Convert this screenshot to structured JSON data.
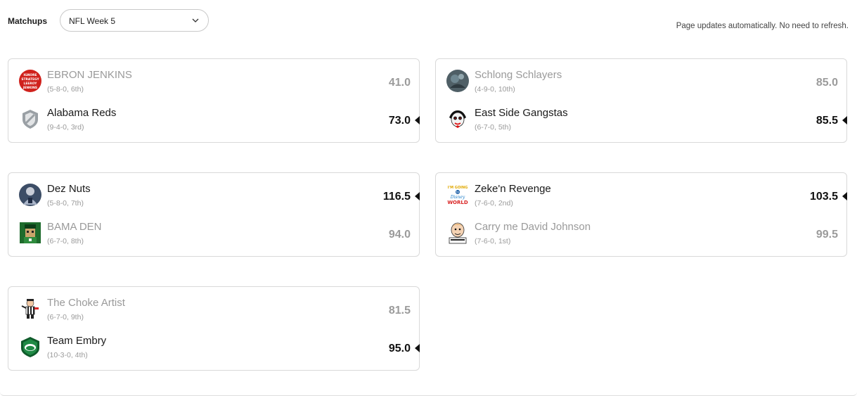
{
  "header": {
    "label": "Matchups",
    "week_select": {
      "value": "NFL Week 5"
    },
    "refresh_note": "Page updates automatically. No need to refresh."
  },
  "matchups": [
    {
      "top": {
        "name": "EBRON JENKINS",
        "record": "(5-8-0, 6th)",
        "score": "41.0",
        "avatar": "ignore-strategy-logo",
        "status": "loser"
      },
      "bottom": {
        "name": "Alabama Reds",
        "record": "(9-4-0, 3rd)",
        "score": "73.0",
        "avatar": "shield-logo",
        "status": "winner"
      }
    },
    {
      "top": {
        "name": "Schlong Schlayers",
        "record": "(4-9-0, 10th)",
        "score": "85.0",
        "avatar": "photo-avatar",
        "status": "loser"
      },
      "bottom": {
        "name": "East Side Gangstas",
        "record": "(6-7-0, 5th)",
        "score": "85.5",
        "avatar": "clown-avatar",
        "status": "winner"
      }
    },
    {
      "top": {
        "name": "Dez Nuts",
        "record": "(5-8-0, 7th)",
        "score": "116.5",
        "avatar": "player-photo-avatar",
        "status": "winner"
      },
      "bottom": {
        "name": "BAMA DEN",
        "record": "(6-7-0, 8th)",
        "score": "94.0",
        "avatar": "green-character-avatar",
        "status": "loser"
      }
    },
    {
      "top": {
        "name": "Zeke'n Revenge",
        "record": "(7-6-0, 2nd)",
        "score": "103.5",
        "avatar": "disney-world-logo",
        "status": "winner"
      },
      "bottom": {
        "name": "Carry me David Johnson",
        "record": "(7-6-0, 1st)",
        "score": "99.5",
        "avatar": "cartoon-face-avatar",
        "status": "loser"
      }
    },
    {
      "top": {
        "name": "The Choke Artist",
        "record": "(6-7-0, 9th)",
        "score": "81.5",
        "avatar": "referee-avatar",
        "status": "loser"
      },
      "bottom": {
        "name": "Team Embry",
        "record": "(10-3-0, 4th)",
        "score": "95.0",
        "avatar": "green-helmet-logo",
        "status": "winner"
      }
    }
  ],
  "logo_text": {
    "ignore_strategy": [
      "IGNORE",
      "STRATEGY",
      "LEEROY",
      "JENKINS"
    ],
    "disney_world": [
      "I'M GOING",
      "to",
      "Disney",
      "WORLD"
    ]
  },
  "colors": {
    "winner_text": "#1a1a1a",
    "loser_text": "#9a9a9a",
    "card_border": "#d9d9d9",
    "select_border": "#c9c9c9"
  }
}
